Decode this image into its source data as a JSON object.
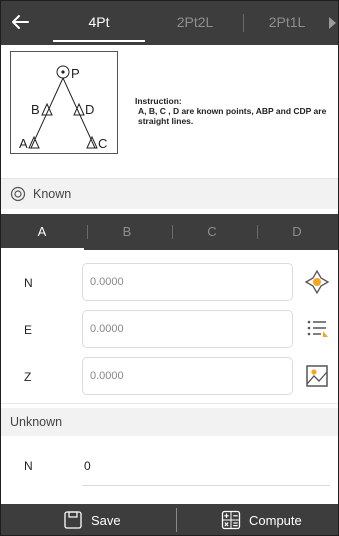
{
  "header": {
    "tabs": [
      {
        "label": "4Pt",
        "active": true
      },
      {
        "label": "2Pt2L",
        "active": false
      },
      {
        "label": "2Pt1L",
        "active": false
      }
    ]
  },
  "diagram": {
    "labels": {
      "p": "P",
      "b": "B",
      "d": "D",
      "a": "A",
      "c": "C"
    }
  },
  "instruction": {
    "title": "Instruction:",
    "text": "A, B, C , D are known points, ABP and CDP are straight lines."
  },
  "known": {
    "label": "Known"
  },
  "point_tabs": [
    {
      "label": "A",
      "active": true
    },
    {
      "label": "B",
      "active": false
    },
    {
      "label": "C",
      "active": false
    },
    {
      "label": "D",
      "active": false
    }
  ],
  "fields": {
    "n": {
      "label": "N",
      "value": "0.0000"
    },
    "e": {
      "label": "E",
      "value": "0.0000"
    },
    "z": {
      "label": "Z",
      "value": "0.0000"
    }
  },
  "unknown": {
    "label": "Unknown",
    "result": {
      "label": "N",
      "value": "0"
    }
  },
  "footer": {
    "save_label": "Save",
    "compute_label": "Compute"
  },
  "colors": {
    "bar": "#3d3d3d",
    "active_text": "#ffffff",
    "inactive_text": "#8e8e8e",
    "section_bg": "#f2f2f2",
    "accent_orange": "#f5a623"
  }
}
